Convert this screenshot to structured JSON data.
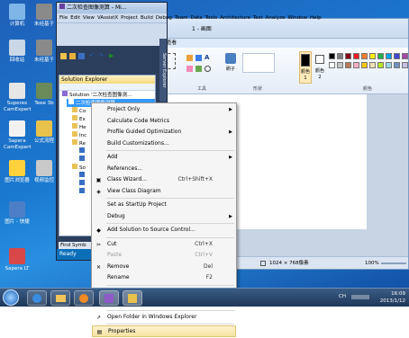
{
  "desktop": {
    "icons": [
      {
        "label": "计算机"
      },
      {
        "label": "未经基于"
      },
      {
        "label": "回收站"
      },
      {
        "label": "未经基于"
      },
      {
        "label": "Superex CamExpert"
      },
      {
        "label": "Teee 3b"
      },
      {
        "label": "Sapera CamExpert"
      },
      {
        "label": "公式流程"
      },
      {
        "label": "图片浏览器"
      },
      {
        "label": "视频监控"
      },
      {
        "label": "图片 - 快捷"
      },
      {
        "label": "Sapera LT"
      }
    ]
  },
  "vs": {
    "title": "二次检查图像测算 - Mi...",
    "menu": [
      "File",
      "Edit",
      "View",
      "VAssistX",
      "Project",
      "Build",
      "Debug",
      "Team",
      "Data",
      "Tools",
      "Architecture",
      "Test",
      "Analyze",
      "Window",
      "Help"
    ],
    "solution_explorer": {
      "title": "Solution Explorer",
      "solution": "Solution '二次检查图像测...",
      "project": "二次检查图像测算",
      "rows": [
        "Co",
        "Ex",
        "He",
        "Inc",
        "Re",
        "",
        "",
        "So",
        "",
        "",
        ""
      ]
    },
    "find_symbol": "Find Symb",
    "status": "Ready",
    "side_tabs": [
      "Server Explorer",
      "Toolbox"
    ]
  },
  "paint": {
    "title": "1 - 画图",
    "tab": "查看",
    "groups": [
      "工具",
      "形状",
      "颜色"
    ],
    "shapes_label": "刷子",
    "color1_label": "颜色 1",
    "color2_label": "颜色 2",
    "status_size": "1024 × 768像素",
    "zoom": "100%",
    "palette": [
      "#000000",
      "#7f7f7f",
      "#880015",
      "#ed1c24",
      "#ff7f27",
      "#fff200",
      "#22b14c",
      "#00a2e8",
      "#3f48cc",
      "#a349a4",
      "#ffffff",
      "#c3c3c3",
      "#b97a57",
      "#ffaec9",
      "#ffc90e",
      "#efe4b0",
      "#b5e61d",
      "#99d9ea",
      "#7092be",
      "#c8bfe7"
    ]
  },
  "context_menu": {
    "items": [
      {
        "icon": "",
        "label": "Project Only",
        "shortcut": "",
        "submenu": true,
        "disabled": false,
        "sep_after": false
      },
      {
        "icon": "",
        "label": "Calculate Code Metrics",
        "shortcut": "",
        "submenu": false,
        "disabled": false,
        "sep_after": false
      },
      {
        "icon": "",
        "label": "Profile Guided Optimization",
        "shortcut": "",
        "submenu": true,
        "disabled": false,
        "sep_after": false
      },
      {
        "icon": "",
        "label": "Build Customizations...",
        "shortcut": "",
        "submenu": false,
        "disabled": false,
        "sep_after": true
      },
      {
        "icon": "",
        "label": "Add",
        "shortcut": "",
        "submenu": true,
        "disabled": false,
        "sep_after": false
      },
      {
        "icon": "",
        "label": "References...",
        "shortcut": "",
        "submenu": false,
        "disabled": false,
        "sep_after": false
      },
      {
        "icon": "▣",
        "label": "Class Wizard...",
        "shortcut": "Ctrl+Shift+X",
        "submenu": false,
        "disabled": false,
        "sep_after": false
      },
      {
        "icon": "◈",
        "label": "View Class Diagram",
        "shortcut": "",
        "submenu": false,
        "disabled": false,
        "sep_after": true
      },
      {
        "icon": "",
        "label": "Set as StartUp Project",
        "shortcut": "",
        "submenu": false,
        "disabled": false,
        "sep_after": false
      },
      {
        "icon": "",
        "label": "Debug",
        "shortcut": "",
        "submenu": true,
        "disabled": false,
        "sep_after": true
      },
      {
        "icon": "◆",
        "label": "Add Solution to Source Control...",
        "shortcut": "",
        "submenu": false,
        "disabled": false,
        "sep_after": true
      },
      {
        "icon": "✂",
        "label": "Cut",
        "shortcut": "Ctrl+X",
        "submenu": false,
        "disabled": false,
        "sep_after": false
      },
      {
        "icon": "",
        "label": "Paste",
        "shortcut": "Ctrl+V",
        "submenu": false,
        "disabled": true,
        "sep_after": false
      },
      {
        "icon": "✕",
        "label": "Remove",
        "shortcut": "Del",
        "submenu": false,
        "disabled": false,
        "sep_after": false
      },
      {
        "icon": "",
        "label": "Rename",
        "shortcut": "F2",
        "submenu": false,
        "disabled": false,
        "sep_after": true
      },
      {
        "icon": "",
        "label": "Unload Project",
        "shortcut": "",
        "submenu": false,
        "disabled": false,
        "sep_after": false
      },
      {
        "icon": "",
        "label": "Rescan Solution",
        "shortcut": "",
        "submenu": false,
        "disabled": false,
        "sep_after": true
      },
      {
        "icon": "↗",
        "label": "Open Folder in Windows Explorer",
        "shortcut": "",
        "submenu": false,
        "disabled": false,
        "sep_after": true
      },
      {
        "icon": "▤",
        "label": "Properties",
        "shortcut": "",
        "submenu": false,
        "disabled": false,
        "highlighted": true,
        "sep_after": false
      }
    ]
  },
  "taskbar": {
    "lang": "CH",
    "time": "16:09",
    "date": "2013/1/12"
  }
}
